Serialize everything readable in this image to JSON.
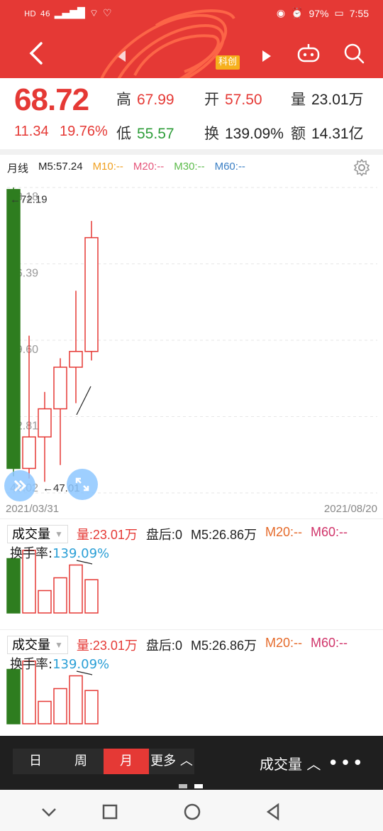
{
  "status": {
    "left": [
      "HD",
      "46"
    ],
    "battery": "97%",
    "time": "7:55"
  },
  "header": {
    "badge": "科创"
  },
  "quote": {
    "price": "68.72",
    "change": "11.34",
    "change_pct": "19.76%",
    "high_label": "高",
    "high": "67.99",
    "open_label": "开",
    "open": "57.50",
    "volume_label": "量",
    "volume": "23.01万",
    "low_label": "低",
    "low": "55.57",
    "turnover_label": "换",
    "turnover": "139.09%",
    "amount_label": "额",
    "amount": "14.31亿"
  },
  "chart": {
    "period_label": "月线",
    "ma5": "M5:57.24",
    "ma10": "M10:--",
    "ma20": "M20:--",
    "ma30": "M30:--",
    "ma60": "M60:--",
    "y_labels": [
      "73.18",
      "66.39",
      "59.60",
      "52.81",
      "46.02"
    ],
    "high_marker": "72.19",
    "low_marker": "47.01",
    "date_start": "2021/03/31",
    "date_end": "2021/08/20",
    "colors": {
      "up": "#e53935",
      "down": "#2e7d1f",
      "grid": "#e6e6e6"
    }
  },
  "chart_data": {
    "type": "candlestick",
    "candles": [
      {
        "open": 73.0,
        "close": 48.2,
        "high": 73.18,
        "low": 47.5
      },
      {
        "open": 48.2,
        "close": 51.0,
        "high": 60.0,
        "low": 47.3
      },
      {
        "open": 51.0,
        "close": 53.5,
        "high": 55.0,
        "low": 47.01
      },
      {
        "open": 53.5,
        "close": 57.2,
        "high": 58.0,
        "low": 48.5
      },
      {
        "open": 57.2,
        "close": 58.6,
        "high": 64.0,
        "low": 54.0
      },
      {
        "open": 58.6,
        "close": 68.72,
        "high": 70.2,
        "low": 57.8
      }
    ],
    "ylim": [
      46.02,
      73.18
    ]
  },
  "volume_panels": [
    {
      "selector": "成交量",
      "vol": "量:23.01万",
      "after": "盘后:0",
      "m5": "M5:26.86万",
      "m20": "M20:--",
      "m60": "M60:--",
      "turn_label": "换手率:",
      "turn": "139.09%"
    },
    {
      "selector": "成交量",
      "vol": "量:23.01万",
      "after": "盘后:0",
      "m5": "M5:26.86万",
      "m20": "M20:--",
      "m60": "M60:--",
      "turn_label": "换手率:",
      "turn": "139.09%"
    }
  ],
  "volume_values": [
    0.85,
    0.98,
    0.35,
    0.55,
    0.75,
    0.52
  ],
  "toolbar": {
    "periods": [
      "日",
      "周",
      "月",
      "更多"
    ],
    "active": 2,
    "indicator": "成交量",
    "more": "•••"
  }
}
